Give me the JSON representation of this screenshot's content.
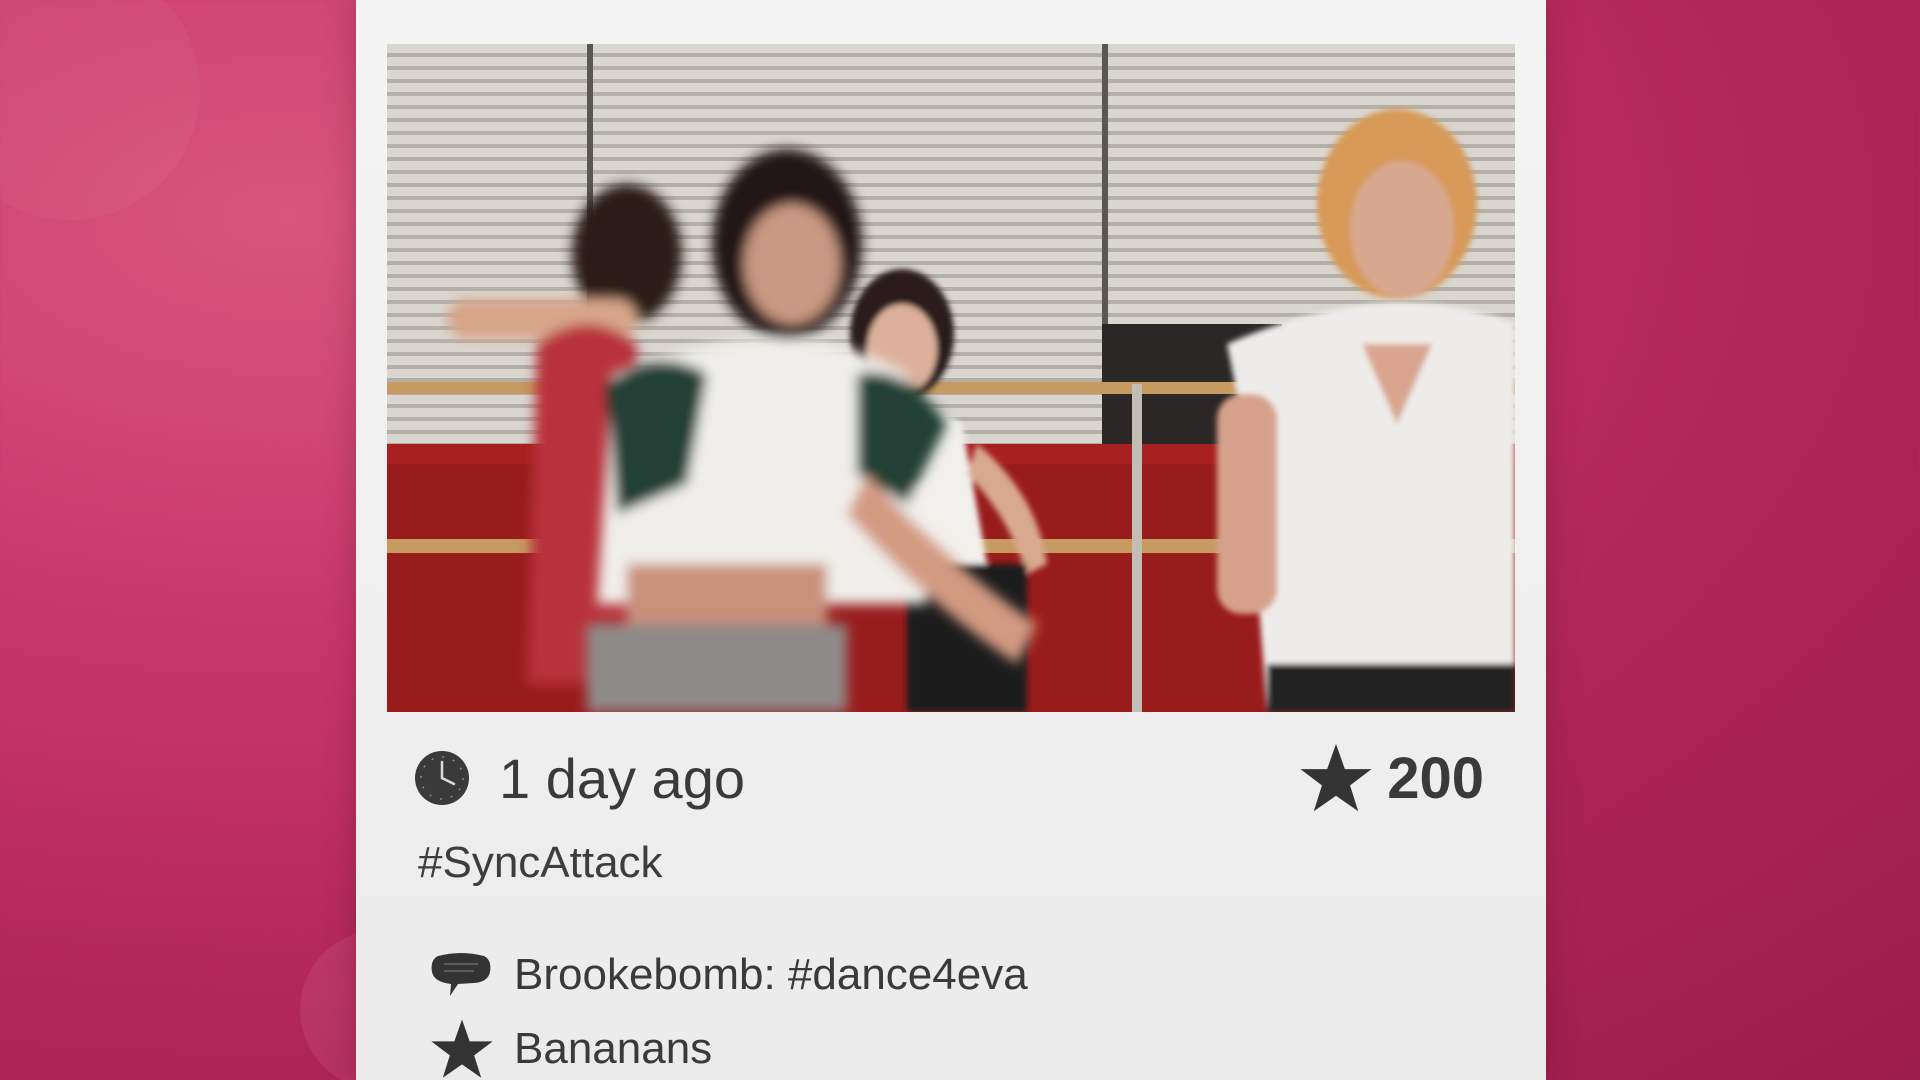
{
  "post": {
    "photo_alt": "Dancers in a studio",
    "time_ago": "1 day ago",
    "score": "200",
    "hashtag": "#SyncAttack",
    "comments": [
      {
        "text": "Brookebomb: #dance4eva"
      }
    ],
    "likes": [
      {
        "text": "Bananans"
      }
    ]
  },
  "colors": {
    "background": "#c7366a",
    "card": "#f2f2f2",
    "text": "#3a3a3a"
  },
  "icons": {
    "clock": "clock-icon",
    "score": "star-icon",
    "comment": "speech-bubble-icon",
    "like": "star-icon"
  }
}
